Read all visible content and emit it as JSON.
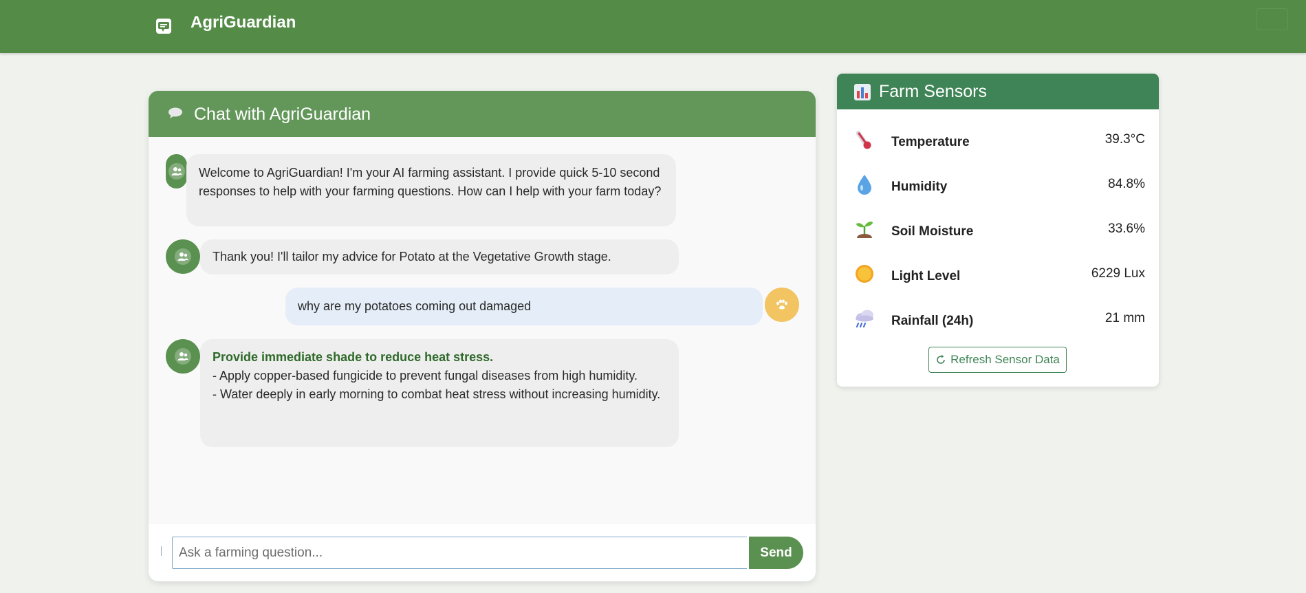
{
  "navbar": {
    "brand": "AgriGuardian",
    "brand_icon": "chat-icon"
  },
  "chat": {
    "header_icon": "speech-bubble-icon",
    "title": "Chat with AgriGuardian",
    "messages": [
      {
        "sender": "assistant",
        "text": "Welcome to AgriGuardian! I'm your AI farming assistant. I provide quick 5-10 second responses to help with your farming questions. How can I help with your farm today?"
      },
      {
        "sender": "assistant",
        "text": "Thank you! I'll tailor my advice for Potato at the Vegetative Growth stage."
      },
      {
        "sender": "user",
        "text": "why are my potatoes coming out damaged"
      },
      {
        "sender": "assistant",
        "heading": "Provide immediate shade to reduce heat stress.",
        "lines": [
          "- Apply copper-based fungicide to prevent fungal diseases from high humidity.",
          "- Water deeply in early morning to combat heat stress without increasing humidity."
        ]
      }
    ],
    "input_placeholder": "Ask a farming question...",
    "send_label": "Send"
  },
  "sensors": {
    "header_icon": "bar-chart-icon",
    "title": "Farm Sensors",
    "items": [
      {
        "icon": "thermometer-icon",
        "label": "Temperature",
        "value": "39.3°C"
      },
      {
        "icon": "droplet-icon",
        "label": "Humidity",
        "value": "84.8%"
      },
      {
        "icon": "seedling-icon",
        "label": "Soil Moisture",
        "value": "33.6%"
      },
      {
        "icon": "sun-icon",
        "label": "Light Level",
        "value": "6229 Lux"
      },
      {
        "icon": "rain-cloud-icon",
        "label": "Rainfall (24h)",
        "value": "21 mm"
      }
    ],
    "refresh_label": "Refresh Sensor Data"
  },
  "colors": {
    "nav_bg": "#548c47",
    "chat_header_bg": "#63975a",
    "sensor_header_bg": "#3f8456",
    "assistant_avatar": "#5b9150",
    "user_avatar": "#f2c462",
    "user_bubble": "#e5eef8",
    "assistant_bubble": "#eeeeee"
  }
}
